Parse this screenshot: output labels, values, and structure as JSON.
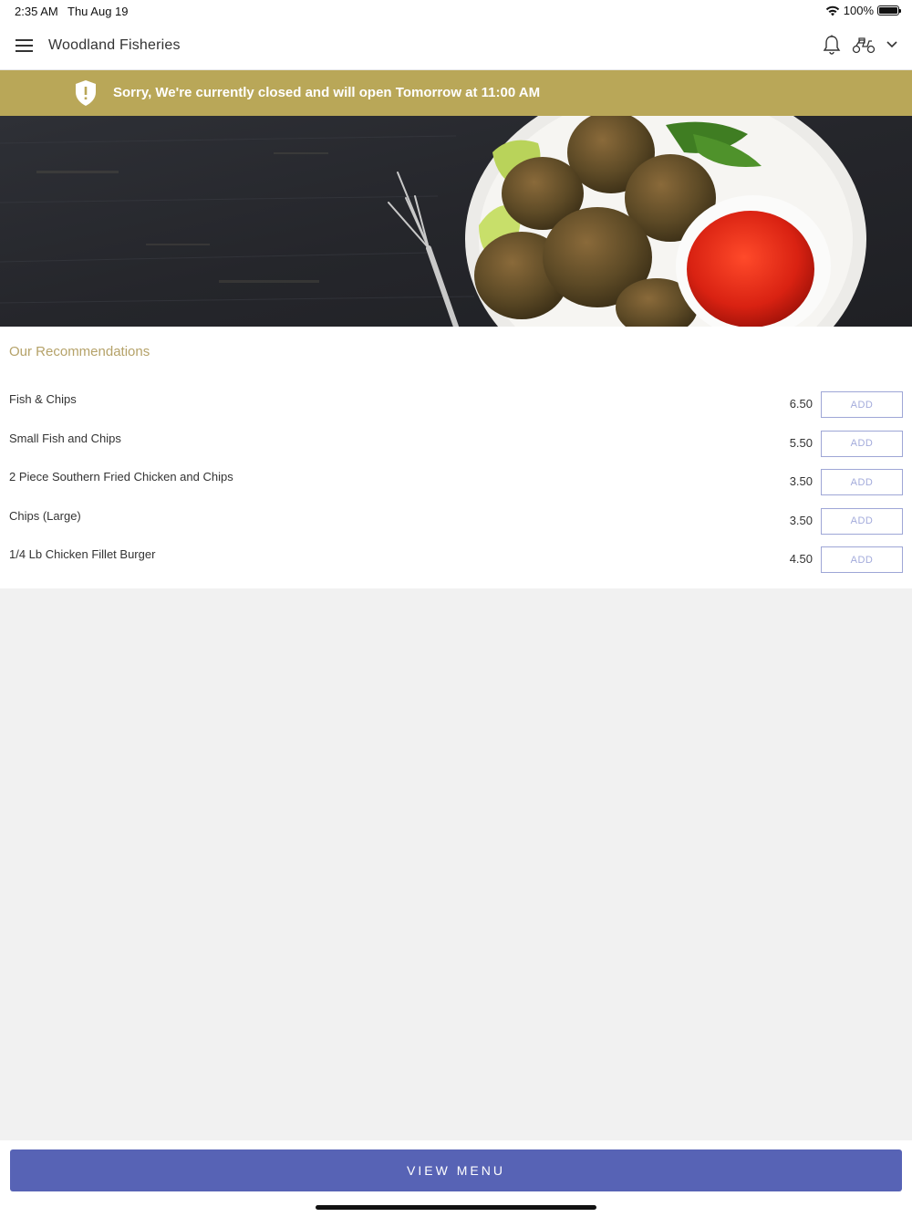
{
  "status_bar": {
    "time": "2:35 AM",
    "date": "Thu Aug 19",
    "battery": "100%"
  },
  "header": {
    "title": "Woodland Fisheries",
    "icons": [
      "menu-icon",
      "bell-icon",
      "scooter-icon",
      "chevron-down-icon"
    ]
  },
  "banner": {
    "message": "Sorry, We're currently closed and will open Tomorrow at 11:00 AM",
    "color": "#b9a758"
  },
  "recommendations": {
    "title": "Our Recommendations",
    "items": [
      {
        "name": "Fish & Chips",
        "price": "6.50",
        "button": "ADD"
      },
      {
        "name": "Small Fish and Chips",
        "price": "5.50",
        "button": "ADD"
      },
      {
        "name": "2 Piece Southern Fried Chicken and Chips",
        "price": "3.50",
        "button": "ADD"
      },
      {
        "name": "Chips (Large)",
        "price": "3.50",
        "button": "ADD"
      },
      {
        "name": "1/4 Lb Chicken Fillet Burger",
        "price": "4.50",
        "button": "ADD"
      }
    ]
  },
  "footer": {
    "view_menu_label": "VIEW MENU",
    "accent": "#5763b5"
  }
}
